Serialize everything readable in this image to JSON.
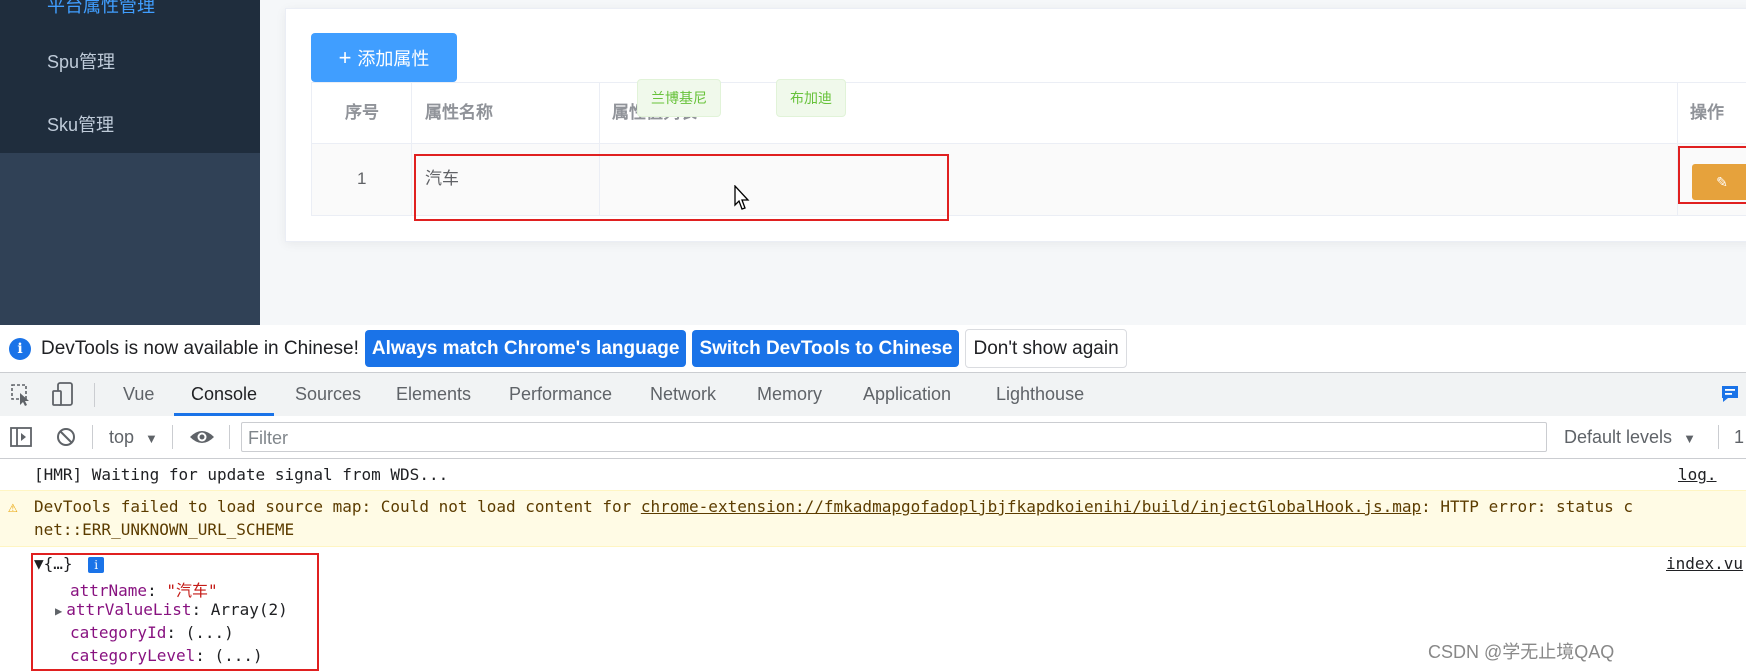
{
  "sidebar": {
    "items": [
      {
        "label": "平台属性管理"
      },
      {
        "label": "Spu管理"
      },
      {
        "label": "Sku管理"
      }
    ]
  },
  "main": {
    "add_button": "添加属性",
    "table": {
      "headers": [
        "序号",
        "属性名称",
        "属性值列表",
        "操作"
      ],
      "rows": [
        {
          "index": "1",
          "name": "汽车",
          "values": [
            "兰博基尼",
            "布加迪"
          ]
        }
      ]
    }
  },
  "devtools": {
    "notice": {
      "message": "DevTools is now available in Chinese!",
      "btn_match": "Always match Chrome's language",
      "btn_switch": "Switch DevTools to Chinese",
      "btn_dismiss": "Don't show again"
    },
    "tabs": [
      "Vue",
      "Console",
      "Sources",
      "Elements",
      "Performance",
      "Network",
      "Memory",
      "Application",
      "Lighthouse"
    ],
    "active_tab": "Console",
    "toolbar": {
      "context": "top",
      "filter_placeholder": "Filter",
      "levels": "Default levels",
      "issues_count": "1"
    },
    "console": {
      "line1": "[HMR] Waiting for update signal from WDS...",
      "line1_src": "log.",
      "warn_prefix": "DevTools failed to load source map: Could not load content for ",
      "warn_url": "chrome-extension://fmkadmapgofadopljbjfkapdkoienihi/build/injectGlobalHook.js.map",
      "warn_suffix": ": HTTP error: status c",
      "warn_line2": "net::ERR_UNKNOWN_URL_SCHEME",
      "obj_header": "▼{…}",
      "obj_src": "index.vu",
      "props": [
        {
          "key": "attrName",
          "value": "\"汽车\""
        },
        {
          "key": "attrValueList",
          "value": "Array(2)"
        },
        {
          "key": "categoryId",
          "value": "(...)"
        },
        {
          "key": "categoryLevel",
          "value": "(...)"
        }
      ]
    }
  },
  "watermark": "CSDN @学无止境QAQ"
}
